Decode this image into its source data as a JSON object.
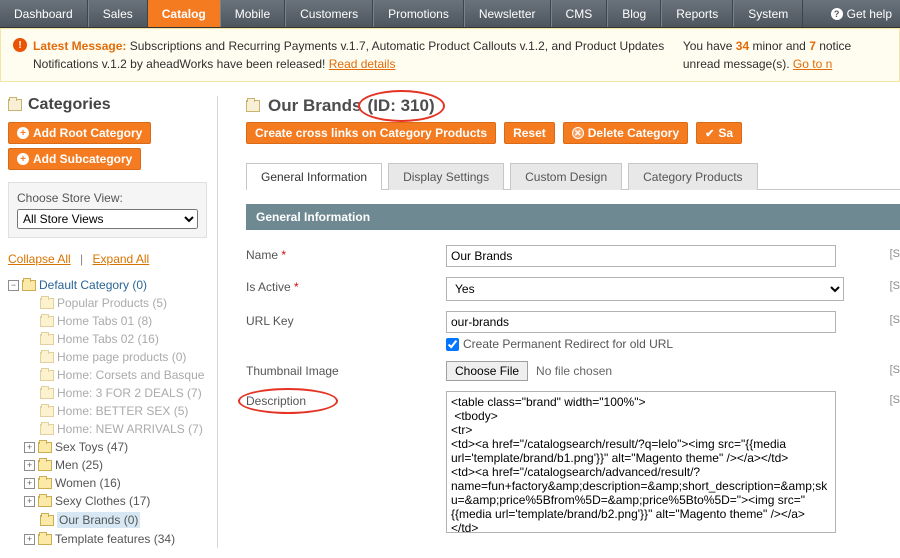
{
  "nav": {
    "items": [
      "Dashboard",
      "Sales",
      "Catalog",
      "Mobile",
      "Customers",
      "Promotions",
      "Newsletter",
      "CMS",
      "Blog",
      "Reports",
      "System"
    ],
    "active_index": 2,
    "help": "Get help"
  },
  "notice": {
    "latest_label": "Latest Message:",
    "body1": "Subscriptions and Recurring Payments v.1.7, Automatic Product Callouts v.1.2, and Product Updates Notifications v.1.2 by aheadWorks have been released! ",
    "read_details": "Read details",
    "you_have": "You have ",
    "minor": "34",
    "minor_txt": " minor and ",
    "notice_n": "7",
    "notice_txt": " notice unread message(s). ",
    "goto": "Go to n"
  },
  "sidebar": {
    "title": "Categories",
    "add_root": "Add Root Category",
    "add_sub": "Add Subcategory",
    "store_label": "Choose Store View:",
    "store_value": "All Store Views",
    "collapse": "Collapse All",
    "expand": "Expand All"
  },
  "tree": {
    "root": "Default Category (0)",
    "children_dim": [
      "Popular Products (5)",
      "Home Tabs 01 (8)",
      "Home Tabs 02 (16)",
      "Home page products (0)",
      "Home: Corsets and Basque",
      "Home: 3 FOR 2 DEALS (7)",
      "Home: BETTER SEX (5)",
      "Home: NEW ARRIVALS (7)"
    ],
    "children_plus": [
      "Sex Toys (47)",
      "Men (25)",
      "Women (16)",
      "Sexy Clothes (17)"
    ],
    "selected": "Our Brands (0)",
    "last": "Template features (34)"
  },
  "page_head": {
    "title_main": "Our Brands",
    "title_id": "(ID: 310)"
  },
  "actions": {
    "cross": "Create cross links on Category Products",
    "reset": "Reset",
    "delete": "Delete Category",
    "save": "Sa"
  },
  "tabs": {
    "items": [
      "General Information",
      "Display Settings",
      "Custom Design",
      "Category Products"
    ],
    "active_index": 0
  },
  "section_title": "General Information",
  "form": {
    "name_label": "Name",
    "name_value": "Our Brands",
    "active_label": "Is Active",
    "active_value": "Yes",
    "urlkey_label": "URL Key",
    "urlkey_value": "our-brands",
    "redirect_label": "Create Permanent Redirect for old URL",
    "thumb_label": "Thumbnail Image",
    "choose_file": "Choose File",
    "no_file": "No file chosen",
    "desc_label": "Description",
    "desc_value": "<table class=\"brand\" width=\"100%\">\n <tbody>\n<tr>\n<td><a href=\"/catalogsearch/result/?q=lelo\"><img src=\"{{media url='template/brand/b1.png'}}\" alt=\"Magento theme\" /></a></td>\n<td><a href=\"/catalogsearch/advanced/result/?name=fun+factory&amp;description=&amp;short_description=&amp;sku=&amp;price%5Bfrom%5D=&amp;price%5Bto%5D=\"><img src=\"{{media url='template/brand/b2.png'}}\" alt=\"Magento theme\" /></a></td>\n<td><a href=\"/catalogsearch/result/?q=tenga\"><img src=\"{{media",
    "scope": "[S"
  }
}
